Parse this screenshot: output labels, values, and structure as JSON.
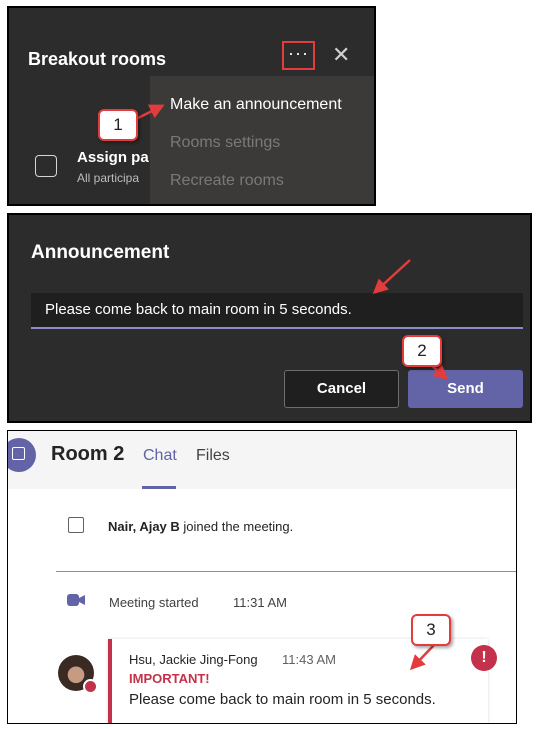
{
  "breakout": {
    "title": "Breakout rooms",
    "more_label": "···",
    "close_label": "✕",
    "assign_title": "Assign pa",
    "assign_sub": "All participa",
    "menu": [
      "Make an announcement",
      "Rooms settings",
      "Recreate rooms"
    ]
  },
  "announcement": {
    "title": "Announcement",
    "text": "Please come back to main room in 5 seconds.",
    "cancel_label": "Cancel",
    "send_label": "Send"
  },
  "room": {
    "title": "Room 2",
    "tabs": [
      "Chat",
      "Files"
    ],
    "join_name": "Nair, Ajay B",
    "join_suffix": " joined the meeting.",
    "meeting_text": "Meeting started",
    "meeting_time": "11:31 AM",
    "message": {
      "author": "Hsu, Jackie Jing-Fong",
      "time": "11:43 AM",
      "importance": "IMPORTANT!",
      "body": "Please come back to main room in 5 seconds.",
      "alert_symbol": "!"
    }
  },
  "callouts": [
    "1",
    "2",
    "3"
  ],
  "colors": {
    "accent": "#6264a7",
    "alert": "#c4314b",
    "callout_border": "#e23c3c",
    "dark_bg": "#2d2c2c"
  }
}
